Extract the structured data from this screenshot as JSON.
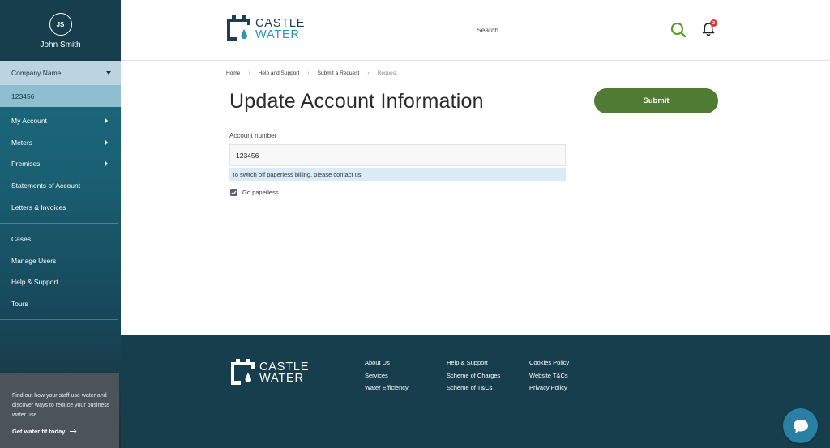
{
  "user": {
    "initials": "JS",
    "name": "John Smith"
  },
  "sidebar": {
    "company_select": "Company Name",
    "account_id": "123456",
    "items": [
      {
        "label": "My Account",
        "has_submenu": true
      },
      {
        "label": "Meters",
        "has_submenu": true
      },
      {
        "label": "Premises",
        "has_submenu": true
      },
      {
        "label": "Statements of Account",
        "has_submenu": false
      },
      {
        "label": "Letters & Invoices",
        "has_submenu": false
      }
    ],
    "items2": [
      {
        "label": "Cases"
      },
      {
        "label": "Manage Users"
      },
      {
        "label": "Help & Support"
      },
      {
        "label": "Tours"
      }
    ],
    "promo": {
      "text": "Find out how your staff use water and discover ways to reduce your business water use",
      "link": "Get water fit today"
    }
  },
  "header": {
    "logo_word1": "CASTLE",
    "logo_word2": "WATER",
    "search_placeholder": "Search...",
    "notification_count": "2"
  },
  "breadcrumb": [
    "Home",
    "Help and Support",
    "Submit a Request",
    "Request"
  ],
  "main": {
    "title": "Update Account Information",
    "submit_label": "Submit",
    "account_label": "Account number",
    "account_value": "123456",
    "info_text": "To switch off paperless billing, please contact us.",
    "checkbox_label": "Go paperless",
    "checkbox_checked": true
  },
  "footer": {
    "col1": [
      "About Us",
      "Services",
      "Water Efficiency"
    ],
    "col2": [
      "Help & Support",
      "Scheme of Charges",
      "Scheme of T&Cs"
    ],
    "col3": [
      "Cookies Policy",
      "Website T&Cs",
      "Privacy Policy"
    ]
  },
  "colors": {
    "brand_dark": "#173e4d",
    "brand_blue": "#2c93ba",
    "submit_green": "#4f7b34",
    "search_green": "#5a9a2f"
  }
}
